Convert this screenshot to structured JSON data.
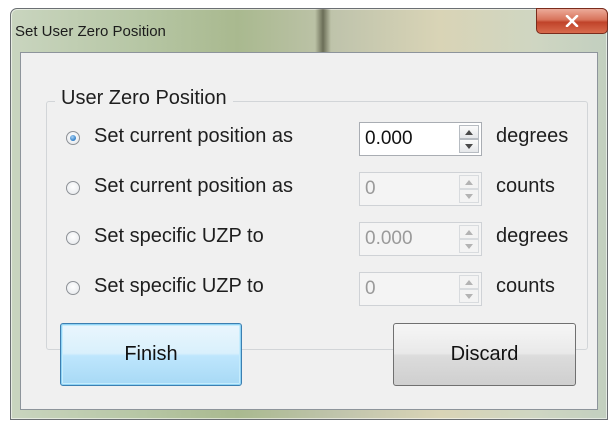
{
  "window": {
    "title": "Set User Zero Position",
    "close_glyph": "X"
  },
  "group": {
    "label": "User Zero Position"
  },
  "rows": [
    {
      "label": "Set current position as",
      "value": "0.000",
      "unit": "degrees",
      "selected": true,
      "enabled": true
    },
    {
      "label": "Set current position as",
      "value": "0",
      "unit": "counts",
      "selected": false,
      "enabled": false
    },
    {
      "label": "Set specific UZP to",
      "value": "0.000",
      "unit": "degrees",
      "selected": false,
      "enabled": false
    },
    {
      "label": "Set specific UZP to",
      "value": "0",
      "unit": "counts",
      "selected": false,
      "enabled": false
    }
  ],
  "buttons": {
    "finish": "Finish",
    "discard": "Discard"
  },
  "icons": {
    "close": "close-icon",
    "spin_up": "chevron-up-icon",
    "spin_down": "chevron-down-icon",
    "radio": "radio-button-icon"
  },
  "colors": {
    "client_background": "#f0f0f0",
    "close_button": "#c8452c",
    "default_button": "#bee6fd",
    "radio_selected": "#2f7ec8"
  }
}
